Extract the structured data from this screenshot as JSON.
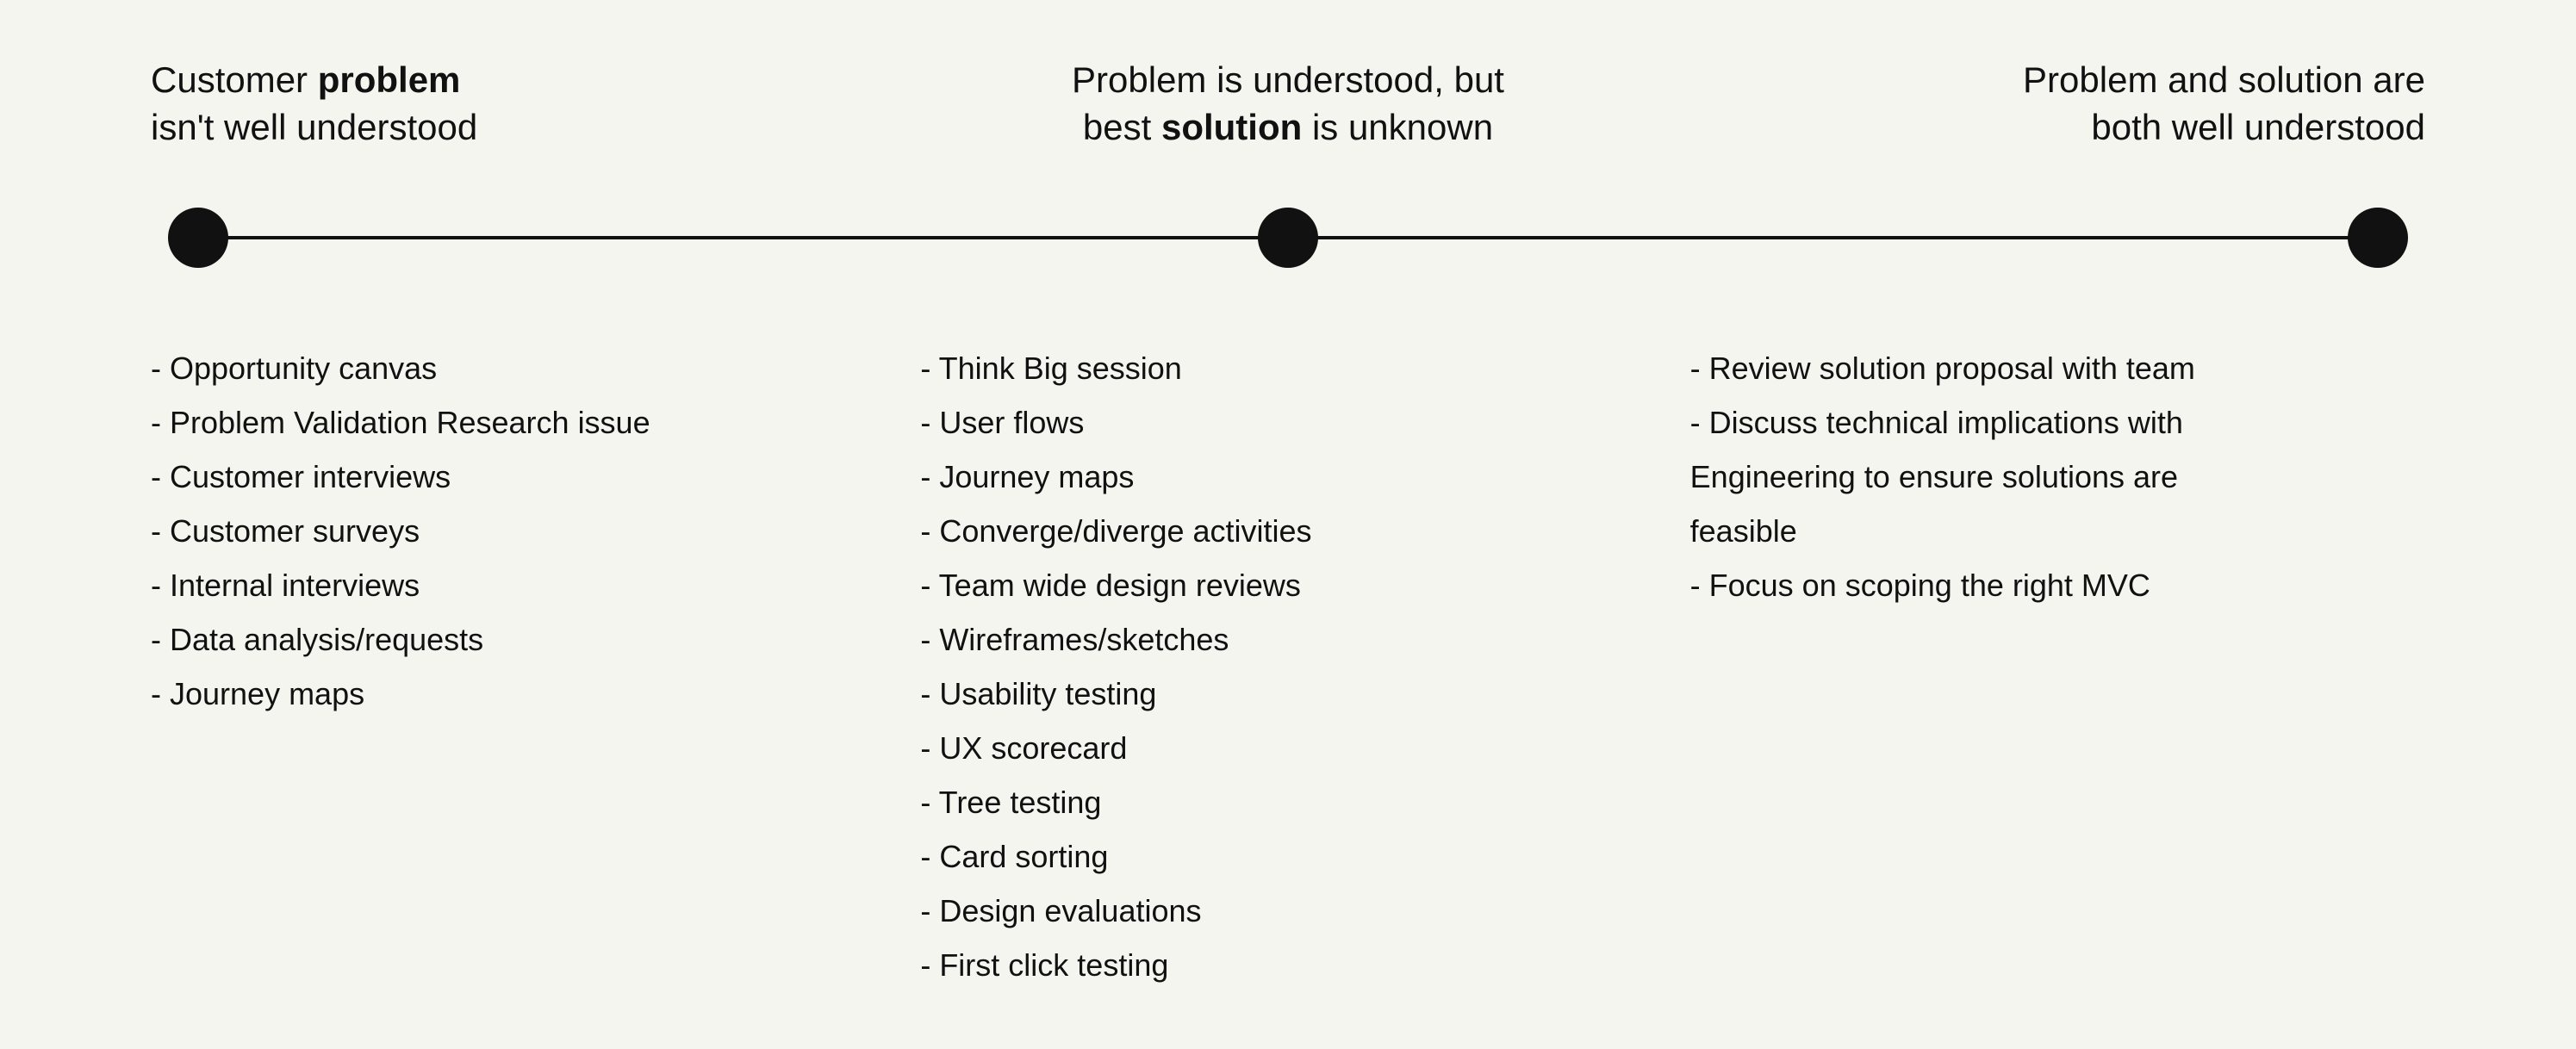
{
  "headers": [
    {
      "id": "header-left",
      "text_before": "Customer ",
      "bold_text": "problem",
      "text_after": "\nisn't well understood"
    },
    {
      "id": "header-middle",
      "text_before": "Problem is understood, but\nbest ",
      "bold_text": "solution",
      "text_after": " is unknown"
    },
    {
      "id": "header-right",
      "text_before": "Problem and solution are\nboth well understood",
      "bold_text": "",
      "text_after": ""
    }
  ],
  "columns": [
    {
      "id": "col-left",
      "items": [
        "- Opportunity canvas",
        "- Problem Validation Research issue",
        "- Customer interviews",
        "- Customer surveys",
        "- Internal interviews",
        "- Data analysis/requests",
        "- Journey maps"
      ]
    },
    {
      "id": "col-middle",
      "items": [
        "- Think Big session",
        "- User flows",
        "- Journey maps",
        "- Converge/diverge activities",
        "- Team wide design reviews",
        "- Wireframes/sketches",
        "- Usability testing",
        "- UX scorecard",
        "- Tree testing",
        "- Card sorting",
        "- Design evaluations",
        "- First click testing"
      ]
    },
    {
      "id": "col-right",
      "items": [
        "- Review solution proposal with team",
        "- Discuss technical implications with",
        "Engineering to ensure solutions are",
        "feasible",
        "- Focus on scoping the right MVC"
      ]
    }
  ]
}
